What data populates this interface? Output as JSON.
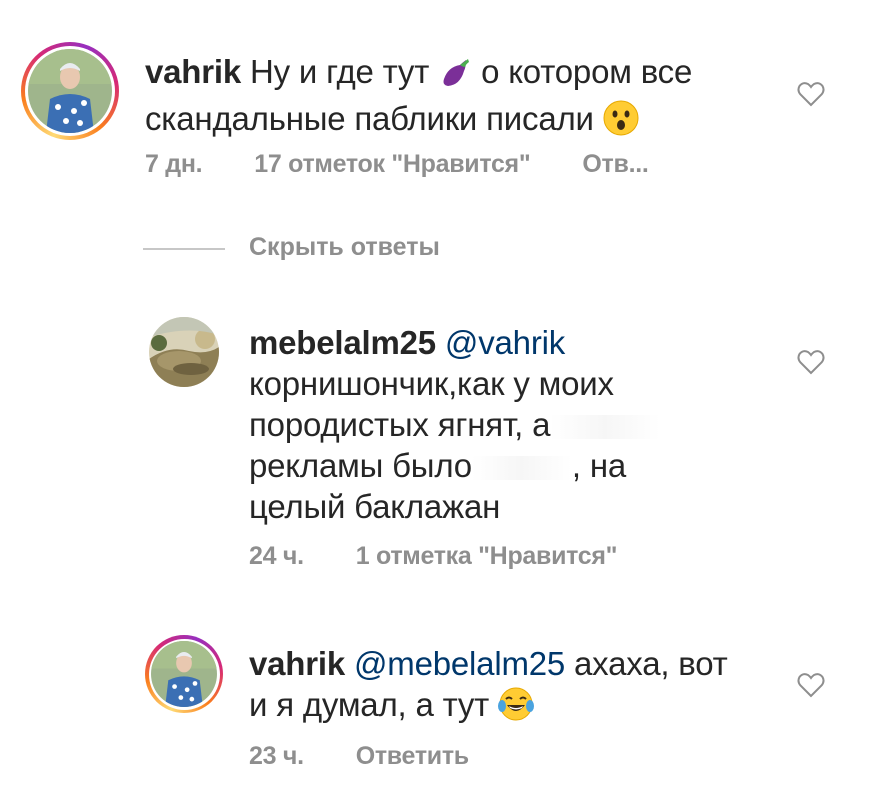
{
  "comments": [
    {
      "username": "vahrik",
      "text_line1": " Ну и где тут ",
      "text_line1b": " о котором все",
      "text_line2": "скандальные паблики писали ",
      "meta_time": "7 дн.",
      "meta_likes": "17 отметок \"Нравится\"",
      "meta_reply": "Отв..."
    },
    {
      "username": "mebelalm25",
      "mention": "@vahrik",
      "line1": "корнишончик,как у моих",
      "line2": "породистых ягнят, а",
      "line3a": "рекламы было",
      "line3b": ", на",
      "line4": "целый баклажан",
      "meta_time": "24 ч.",
      "meta_likes": "1 отметка \"Нравится\""
    },
    {
      "username": "vahrik",
      "mention": "@mebelalm25",
      "line1_rest": " ахаха, вот",
      "line2": "и я думал, а тут ",
      "meta_time": "23 ч.",
      "meta_reply": "Ответить"
    }
  ],
  "hide_replies": "Скрыть ответы",
  "colors": {
    "link": "#00376b",
    "meta": "#8e8e8e",
    "text": "#262626"
  },
  "icons": [
    "eggplant-icon",
    "astonished-face-icon",
    "laughing-tears-icon",
    "heart-outline-icon"
  ]
}
